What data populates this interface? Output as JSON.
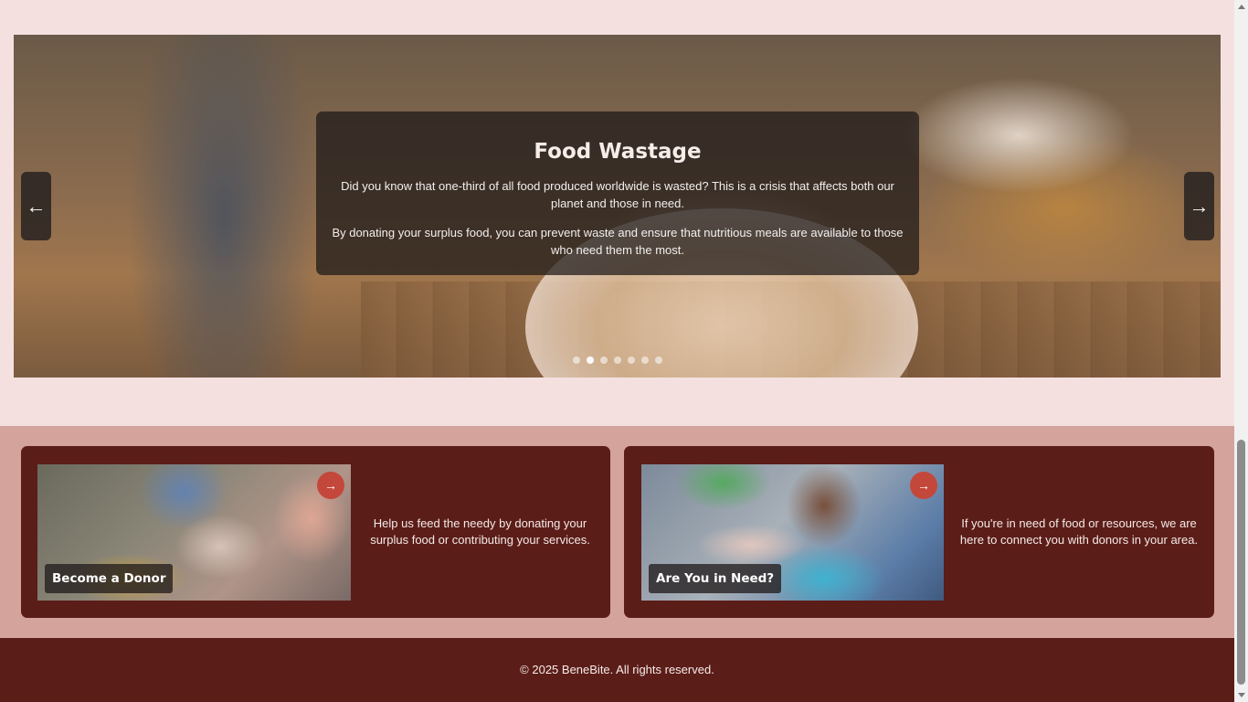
{
  "carousel": {
    "title": "Food Wastage",
    "paragraph1": "Did you know that one-third of all food produced worldwide is wasted? This is a crisis that affects both our planet and those in need.",
    "paragraph2": "By donating your surplus food, you can prevent waste and ensure that nutritious meals are available to those who need them the most.",
    "prev_label": "←",
    "next_label": "→",
    "slide_count": 7,
    "active_slide": 2
  },
  "cards": [
    {
      "title": "Become a Donor",
      "description": "Help us feed the needy by donating your surplus food or contributing your services.",
      "arrow": "→"
    },
    {
      "title": "Are You in Need?",
      "description": "If you're in need of food or resources, we are here to connect you with donors in your area.",
      "arrow": "→"
    }
  ],
  "footer": {
    "text": "© 2025 BeneBite. All rights reserved."
  },
  "colors": {
    "page_bg": "#f4e0df",
    "section_bg": "#d4a39c",
    "card_bg": "#5b1d18",
    "accent": "#c4473b",
    "footer_bg": "#5b1d18"
  }
}
